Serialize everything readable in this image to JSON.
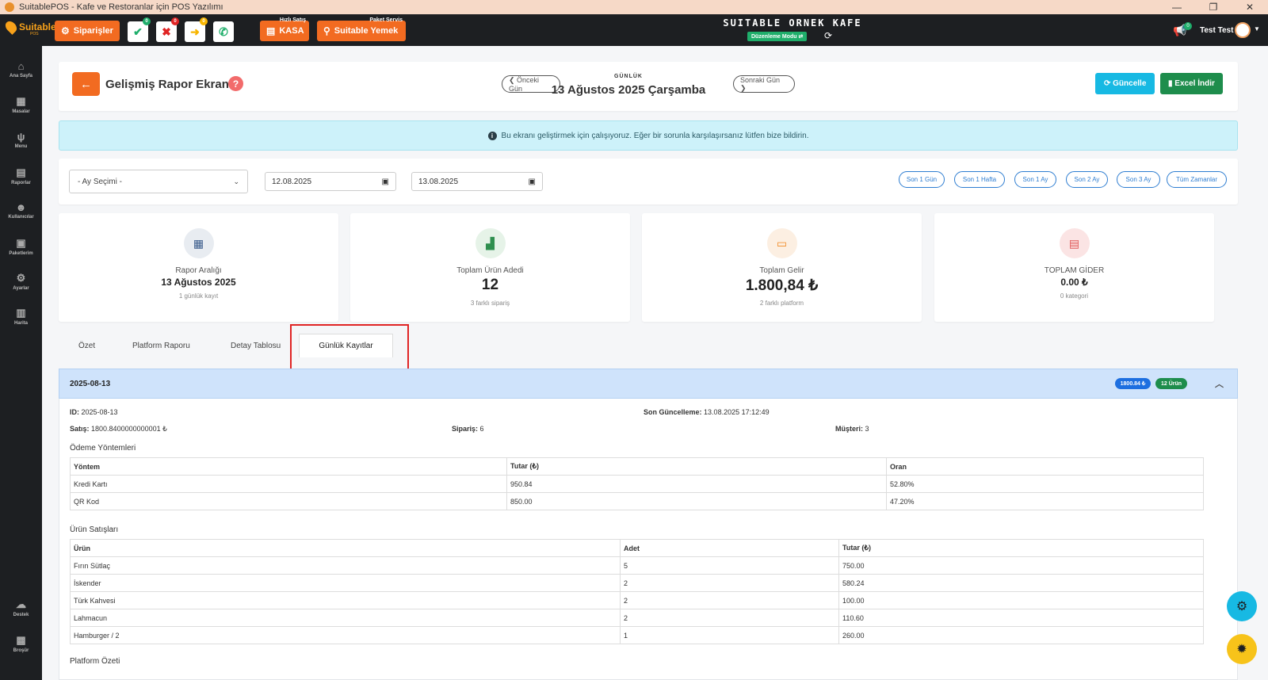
{
  "window": {
    "title": "SuitablePOS - Kafe ve Restoranlar için POS Yazılımı",
    "minimize": "—",
    "maximize": "❐",
    "close": "✕"
  },
  "topbar": {
    "logo_text": "Suitable",
    "logo_sub": "POS",
    "orders_label": "Siparişler",
    "quick_buttons": [
      {
        "icon": "check-icon",
        "glyph": "✔",
        "badge": "0",
        "color": "#1fae6b"
      },
      {
        "icon": "x-icon",
        "glyph": "✖",
        "badge": "0",
        "color": "#e02424"
      },
      {
        "icon": "arrow-right-icon",
        "glyph": "➜",
        "badge": "0",
        "color": "#f7b500"
      },
      {
        "icon": "phone-icon",
        "glyph": "✆",
        "badge": "",
        "color": "#1fae6b"
      }
    ],
    "quick_sale_label": "Hızlı Satış",
    "kasa_label": "KASA",
    "package_label": "Paket Servis",
    "suitable_yemek_label": "Suitable Yemek",
    "cafe_name": "SUITABLE ORNEK KAFE",
    "edit_mode": "Düzenleme Modu ⇄",
    "notification_badge": "0",
    "user_name": "Test Test"
  },
  "sidebar": {
    "items": [
      {
        "label": "Ana Sayfa",
        "icon": "home-icon",
        "glyph": "⌂"
      },
      {
        "label": "Masalar",
        "icon": "tables-icon",
        "glyph": "▦"
      },
      {
        "label": "Menu",
        "icon": "menu-icon",
        "glyph": "ψ"
      },
      {
        "label": "Raporlar",
        "icon": "reports-icon",
        "glyph": "▤"
      },
      {
        "label": "Kullanıcılar",
        "icon": "users-icon",
        "glyph": "☻"
      },
      {
        "label": "Paketlerim",
        "icon": "packages-icon",
        "glyph": "▣"
      },
      {
        "label": "Ayarlar",
        "icon": "settings-icon",
        "glyph": "⚙"
      },
      {
        "label": "Harita",
        "icon": "map-icon",
        "glyph": "▥"
      },
      {
        "label": "Destek",
        "icon": "support-icon",
        "glyph": "☁"
      },
      {
        "label": "Broşür",
        "icon": "brochure-icon",
        "glyph": "▩"
      }
    ]
  },
  "header": {
    "title": "Gelişmiş Rapor Ekranı",
    "prev_day": "❮ Önceki Gün",
    "next_day": "Sonraki Gün ❯",
    "period_type": "GÜNLÜK",
    "period_date": "13 Ağustos 2025 Çarşamba",
    "update_label": "⟳ Güncelle",
    "excel_label": "▮ Excel İndir"
  },
  "alert": {
    "text": "Bu ekranı geliştirmek için çalışıyoruz. Eğer bir sorunla karşılaşırsanız lütfen bize bildirin."
  },
  "filters": {
    "month_select": "- Ay Seçimi -",
    "start_date": "12.08.2025",
    "end_date": "13.08.2025",
    "ranges": [
      "Son 1 Gün",
      "Son 1 Hafta",
      "Son 1 Ay",
      "Son 2 Ay",
      "Son 3 Ay",
      "Tüm Zamanlar"
    ]
  },
  "stats": [
    {
      "label": "Rapor Aralığı",
      "value": "13 Ağustos 2025",
      "sub": "1 günlük kayıt",
      "icon": "calendar-icon",
      "glyph": "▦",
      "bg": "#e8ecf1",
      "fg": "#3b5c8c"
    },
    {
      "label": "Toplam Ürün Adedi",
      "value": "12",
      "sub": "3 farklı sipariş",
      "icon": "boxes-icon",
      "glyph": "▟",
      "bg": "#e6f3e8",
      "fg": "#2f8f4f"
    },
    {
      "label": "Toplam Gelir",
      "value": "1.800,84 ₺",
      "sub": "2 farklı platform",
      "icon": "money-icon",
      "glyph": "▭",
      "bg": "#fcefe2",
      "fg": "#f08a24"
    },
    {
      "label": "TOPLAM GİDER",
      "value": "0.00 ₺",
      "sub": "0 kategori",
      "icon": "receipt-icon",
      "glyph": "▤",
      "bg": "#fbe4e4",
      "fg": "#e05555"
    }
  ],
  "tabs": [
    "Özet",
    "Platform Raporu",
    "Detay Tablosu",
    "Günlük Kayıtlar"
  ],
  "record": {
    "date": "2025-08-13",
    "revenue_badge": "1800.84 ₺",
    "items_badge": "12 Ürün",
    "id_label": "ID:",
    "id_value": "2025-08-13",
    "updated_label": "Son Güncelleme:",
    "updated_value": "13.08.2025 17:12:49",
    "sales_label": "Satış:",
    "sales_value": "1800.8400000000001 ₺",
    "orders_label": "Sipariş:",
    "orders_value": "6",
    "customers_label": "Müşteri:",
    "customers_value": "3",
    "payments_title": "Ödeme Yöntemleri",
    "payments_headers": [
      "Yöntem",
      "Tutar (₺)",
      "Oran"
    ],
    "payments": [
      [
        "Kredi Kartı",
        "950.84",
        "52.80%"
      ],
      [
        "QR Kod",
        "850.00",
        "47.20%"
      ]
    ],
    "products_title": "Ürün Satışları",
    "products_headers": [
      "Ürün",
      "Adet",
      "Tutar (₺)"
    ],
    "products": [
      [
        "Fırın Sütlaç",
        "5",
        "750.00"
      ],
      [
        "İskender",
        "2",
        "580.24"
      ],
      [
        "Türk Kahvesi",
        "2",
        "100.00"
      ],
      [
        "Lahmacun",
        "2",
        "110.60"
      ],
      [
        "Hamburger / 2",
        "1",
        "260.00"
      ]
    ],
    "platform_title": "Platform Özeti"
  },
  "fab": {
    "settings_glyph": "⚙",
    "idea_glyph": "✹"
  }
}
